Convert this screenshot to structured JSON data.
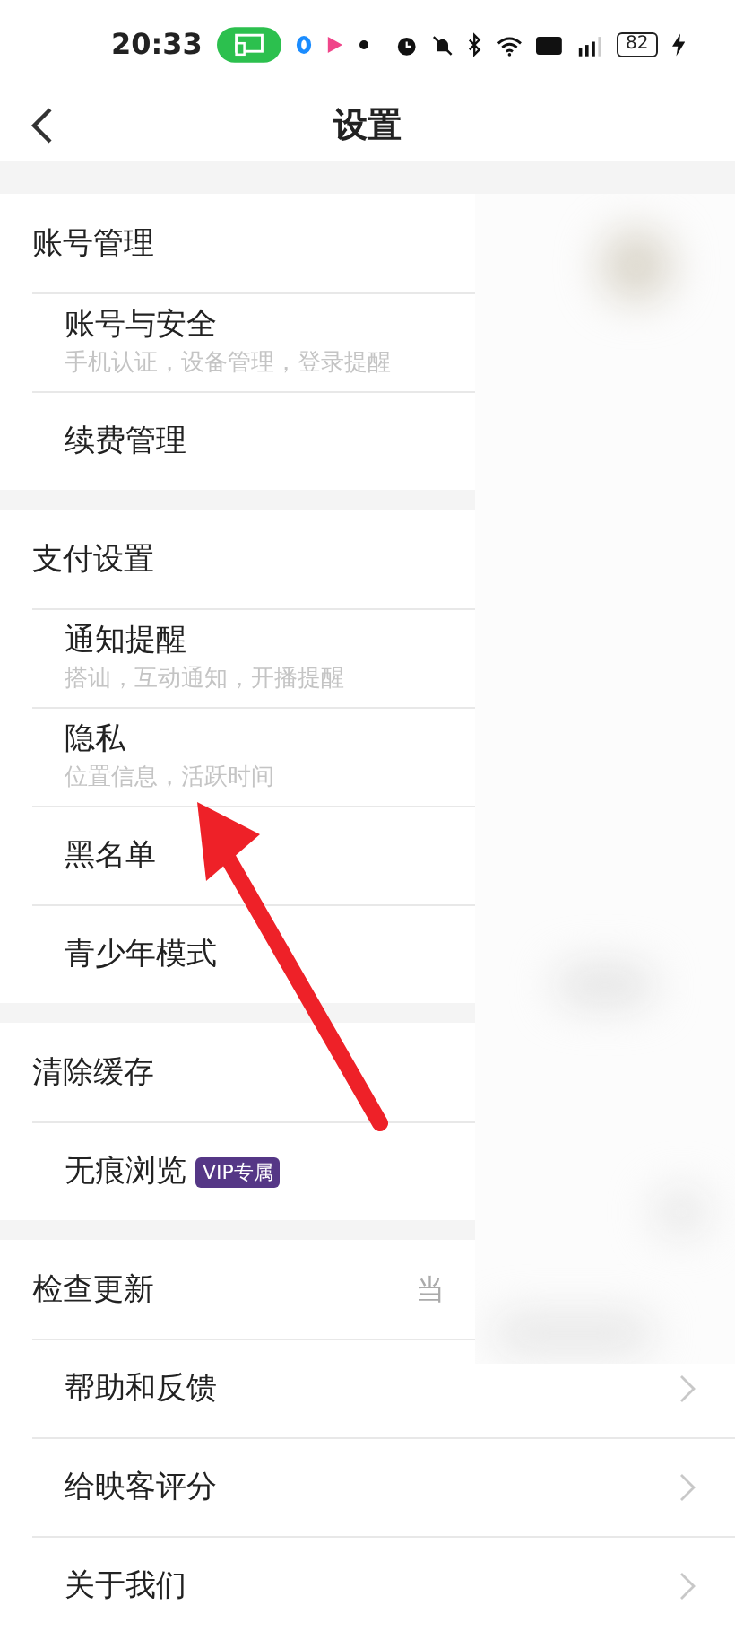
{
  "status_bar": {
    "time": "20:33",
    "battery": "82"
  },
  "header": {
    "title": "设置"
  },
  "groups": [
    {
      "items": [
        {
          "title": "账号管理",
          "chevron": false
        },
        {
          "title": "账号与安全",
          "subtitle": "手机认证，设备管理，登录提醒",
          "chevron": false
        },
        {
          "title": "续费管理",
          "chevron": false
        }
      ]
    },
    {
      "items": [
        {
          "title": "支付设置",
          "chevron": false
        },
        {
          "title": "通知提醒",
          "subtitle": "搭讪，互动通知，开播提醒",
          "chevron": false
        },
        {
          "title": "隐私",
          "subtitle": "位置信息，活跃时间",
          "chevron": false
        },
        {
          "title": "黑名单",
          "chevron": false
        },
        {
          "title": "青少年模式",
          "chevron": false
        }
      ]
    },
    {
      "items": [
        {
          "title": "清除缓存",
          "chevron": false
        },
        {
          "title": "无痕浏览",
          "badge": "VIP专属",
          "chevron": false
        }
      ]
    },
    {
      "items": [
        {
          "title": "检查更新",
          "value": "当",
          "chevron": false
        },
        {
          "title": "帮助和反馈",
          "chevron": true
        },
        {
          "title": "给映客评分",
          "chevron": true
        },
        {
          "title": "关于我们",
          "chevron": true
        }
      ]
    }
  ]
}
